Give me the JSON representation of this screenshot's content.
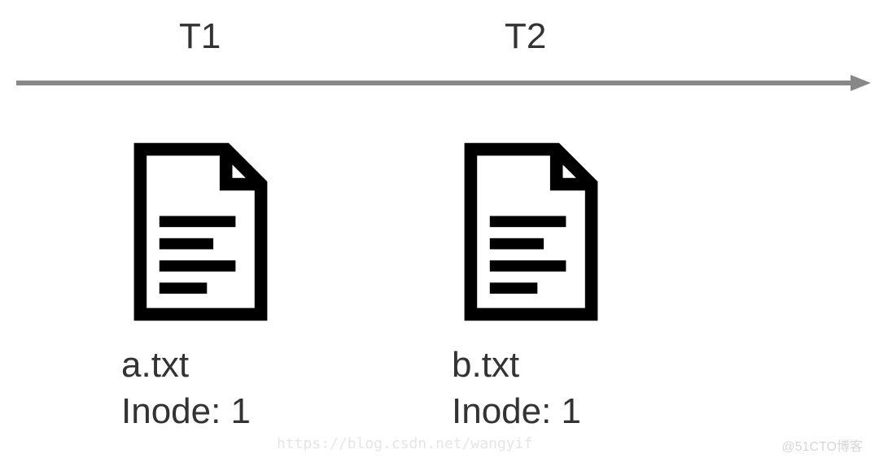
{
  "timeline": {
    "labels": [
      "T1",
      "T2"
    ]
  },
  "files": [
    {
      "filename": "a.txt",
      "inode_label": "Inode: 1"
    },
    {
      "filename": "b.txt",
      "inode_label": "Inode: 1"
    }
  ],
  "watermark": "https://blog.csdn.net/wangyif",
  "watermark2": "@51CTO博客",
  "chart_data": {
    "type": "diagram",
    "title": "",
    "description": "Timeline showing two file states T1 and T2, where a.txt and b.txt both reference Inode 1 (hard link illustration)",
    "timepoints": [
      {
        "label": "T1",
        "file": "a.txt",
        "inode": 1
      },
      {
        "label": "T2",
        "file": "b.txt",
        "inode": 1
      }
    ]
  }
}
